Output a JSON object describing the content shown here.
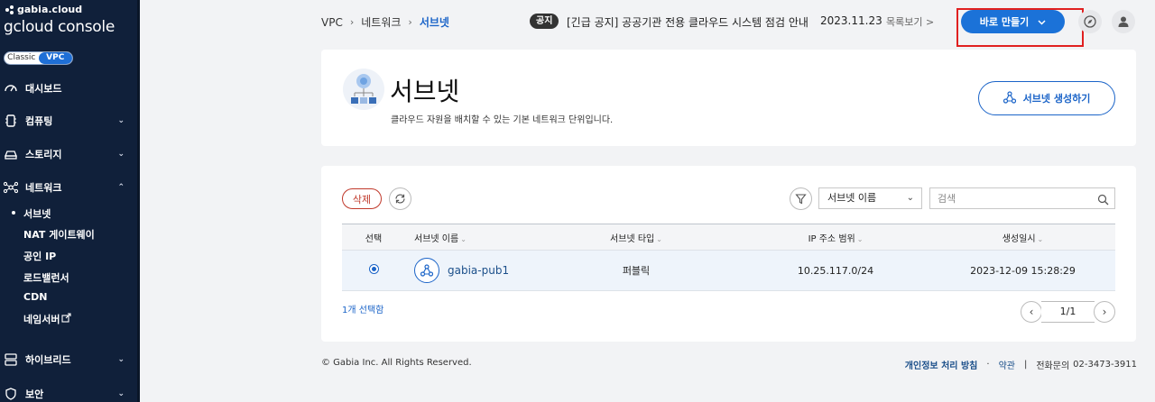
{
  "sidebar": {
    "brand_small": "gabia.cloud",
    "brand_big": "gcloud console",
    "toggle": {
      "classic": "Classic",
      "vpc": "VPC"
    },
    "items": [
      {
        "label": "대시보드",
        "chevron": ""
      },
      {
        "label": "컴퓨팅",
        "chevron": "⌄"
      },
      {
        "label": "스토리지",
        "chevron": "⌄"
      },
      {
        "label": "네트워크",
        "chevron": "⌃"
      },
      {
        "label": "하이브리드",
        "chevron": "⌄"
      },
      {
        "label": "보안",
        "chevron": "⌄"
      }
    ],
    "network_sub": [
      "서브넷",
      "NAT 게이트웨이",
      "공인 IP",
      "로드밸런서",
      "CDN",
      "네임서버"
    ]
  },
  "header": {
    "breadcrumb": [
      "VPC",
      "네트워크",
      "서브넷"
    ],
    "notice_badge": "공지",
    "notice_text": "[긴급 공지] 공공기관 전용 클라우드 시스템 점검 안내",
    "notice_date": "2023.11.23",
    "notice_list": "목록보기 >",
    "quick_create": "바로 만들기"
  },
  "title_card": {
    "title": "서브넷",
    "description": "클라우드 자원을 배치할 수 있는 기본 네트워크 단위입니다.",
    "create_button": "서브넷 생성하기"
  },
  "toolbar": {
    "delete": "삭제",
    "filter_select": "서브넷 이름",
    "search_placeholder": "검색"
  },
  "table": {
    "columns": [
      "선택",
      "서브넷 이름",
      "서브넷 타입",
      "IP 주소 범위",
      "생성일시"
    ],
    "rows": [
      {
        "name": "gabia-pub1",
        "type": "퍼블릭",
        "ip_range": "10.25.117.0/24",
        "created": "2023-12-09 15:28:29",
        "selected": true
      }
    ],
    "selected_count": "1개 선택함",
    "pagination": "1/1"
  },
  "footer": {
    "copyright": "© Gabia Inc. All Rights Reserved.",
    "privacy": "개인정보 처리 방침",
    "terms": "약관",
    "phone_label": "전화문의",
    "phone": "02-3473-3911"
  },
  "colors": {
    "sidebar_bg": "#10203a",
    "accent": "#1b64c8",
    "quick_btn": "#1b72d8",
    "delete": "#c0392b",
    "highlight_box": "#e02020"
  }
}
